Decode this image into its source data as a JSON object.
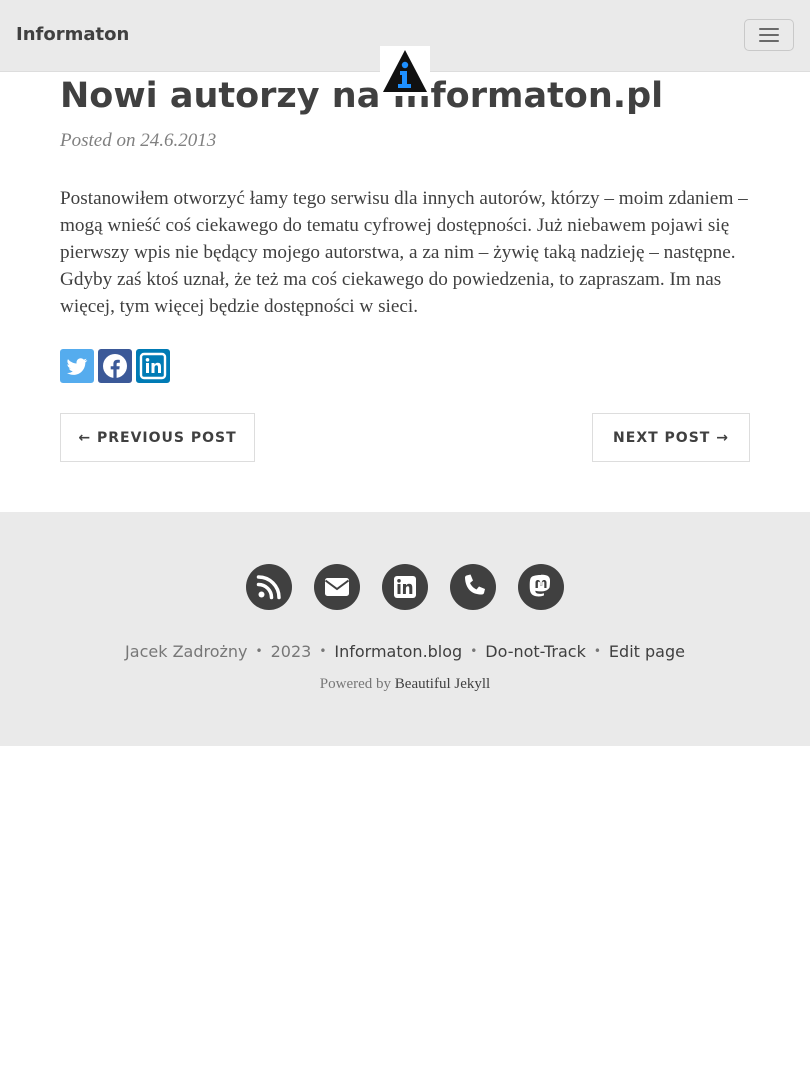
{
  "navbar": {
    "brand": "Informaton",
    "menu_icon": "hamburger-menu-icon",
    "logo_icon": "informaton-logo-icon"
  },
  "post": {
    "title": "Nowi autorzy na Informaton.pl",
    "meta": "Posted on 24.6.2013",
    "body": "Postanowiłem otworzyć łamy tego serwisu dla innych autorów, którzy – moim zdaniem – mogą wnieść coś ciekawego do tematu cyfrowej dostępności. Już niebawem pojawi się pierwszy wpis nie będący mojego autorstwa, a za nim – żywię taką nadzieję – następne. Gdyby zaś ktoś uznał, że też ma coś ciekawego do powiedzenia, to zapraszam. Im nas więcej, tym więcej będzie dostępności w sieci."
  },
  "share": {
    "items": [
      {
        "icon": "twitter-icon",
        "color": "#55acee"
      },
      {
        "icon": "facebook-icon",
        "color": "#3b5998"
      },
      {
        "icon": "linkedin-icon",
        "color": "#007bb5"
      }
    ]
  },
  "pager": {
    "previous": "← PREVIOUS POST",
    "next": "NEXT POST →"
  },
  "footer": {
    "social_icons": [
      "rss-icon",
      "envelope-icon",
      "linkedin-icon",
      "phone-icon",
      "mastodon-icon"
    ],
    "author": "Jacek Zadrożny",
    "year": "2023",
    "site": "Informaton.blog",
    "dnt": "Do-not-Track",
    "edit": "Edit page",
    "separator": "•",
    "powered_prefix": "Powered by",
    "powered_link": "Beautiful Jekyll"
  },
  "colors": {
    "navbar_bg": "#eaeaea",
    "text": "#404040",
    "meta": "#808080",
    "footer_bg": "#eaeaea",
    "logo_accent": "#1e90ff"
  }
}
